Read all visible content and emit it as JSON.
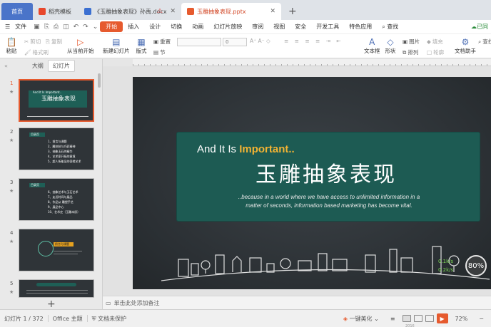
{
  "tabs": [
    {
      "label": "首页"
    },
    {
      "label": "稻壳模板"
    },
    {
      "label": "《玉雕抽象表现》孙禹.docx"
    },
    {
      "label": "玉雕抽象表现.pptx"
    }
  ],
  "menu": {
    "file": "文件",
    "items": [
      "开始",
      "插入",
      "设计",
      "切换",
      "动画",
      "幻灯片放映",
      "审阅",
      "视图",
      "安全",
      "开发工具",
      "特色应用"
    ],
    "active": "开始",
    "search": "查找",
    "cloud": "已同"
  },
  "ribbon": {
    "paste": "粘贴",
    "cut": "剪切",
    "copy": "复制",
    "format_painter": "格式刷",
    "from_current": "从当前开始",
    "new_slide": "新建幻灯片",
    "layout": "版式",
    "section": "节",
    "reset": "重置",
    "font_size": "0",
    "textbox": "文本框",
    "shape": "形状",
    "arrange": "排列",
    "picture": "图片",
    "fill": "填充",
    "outline": "轮廓",
    "doc_helper": "文档助手",
    "find": "查找"
  },
  "leftpanel": {
    "tab_outline": "大纲",
    "tab_slides": "幻灯片",
    "thumbs": [
      {
        "num": "1",
        "title": "玉雕抽象表现",
        "kicker": "And It Is Important.."
      },
      {
        "num": "2",
        "header": "目录页",
        "lines": [
          "1、前言与课题",
          "2、雕刻技与巧匠精神",
          "3、抽象玉石的精华",
          "4、艺术家开拓的意境",
          "5、超人所能见的奇缘艺术"
        ]
      },
      {
        "num": "3",
        "header": "目录页",
        "lines": [
          "6、抽象艺术与玉石艺术",
          "7、走近时间与展品",
          "8、作品从 雕塑手艺",
          "9、展品中心",
          "10、艺术史（玉雕本质）"
        ]
      },
      {
        "num": "4",
        "header": "前言与课题"
      },
      {
        "num": "5",
        "header": ""
      }
    ]
  },
  "slide": {
    "kicker_pre": "And It Is ",
    "kicker_em": "Important..",
    "title": "玉雕抽象表现",
    "body": "..because in a world where we have access to unlimited information in a matter of seconds, information based marketing has become vital.",
    "percent": "80%",
    "speed_up": "0.1k/s",
    "speed_down": "0.2k/s"
  },
  "notes_placeholder": "单击此处添加备注",
  "status": {
    "slide_count": "幻灯片 1 / 372",
    "theme": "Office 主题",
    "protection": "文档未保护",
    "beautify": "一键美化",
    "zoom": "72%",
    "year": "2016"
  },
  "colors": {
    "accent": "#e65a2e",
    "slide_bg": "#2c3135",
    "panel": "#1d5b53",
    "highlight": "#f2b333"
  }
}
